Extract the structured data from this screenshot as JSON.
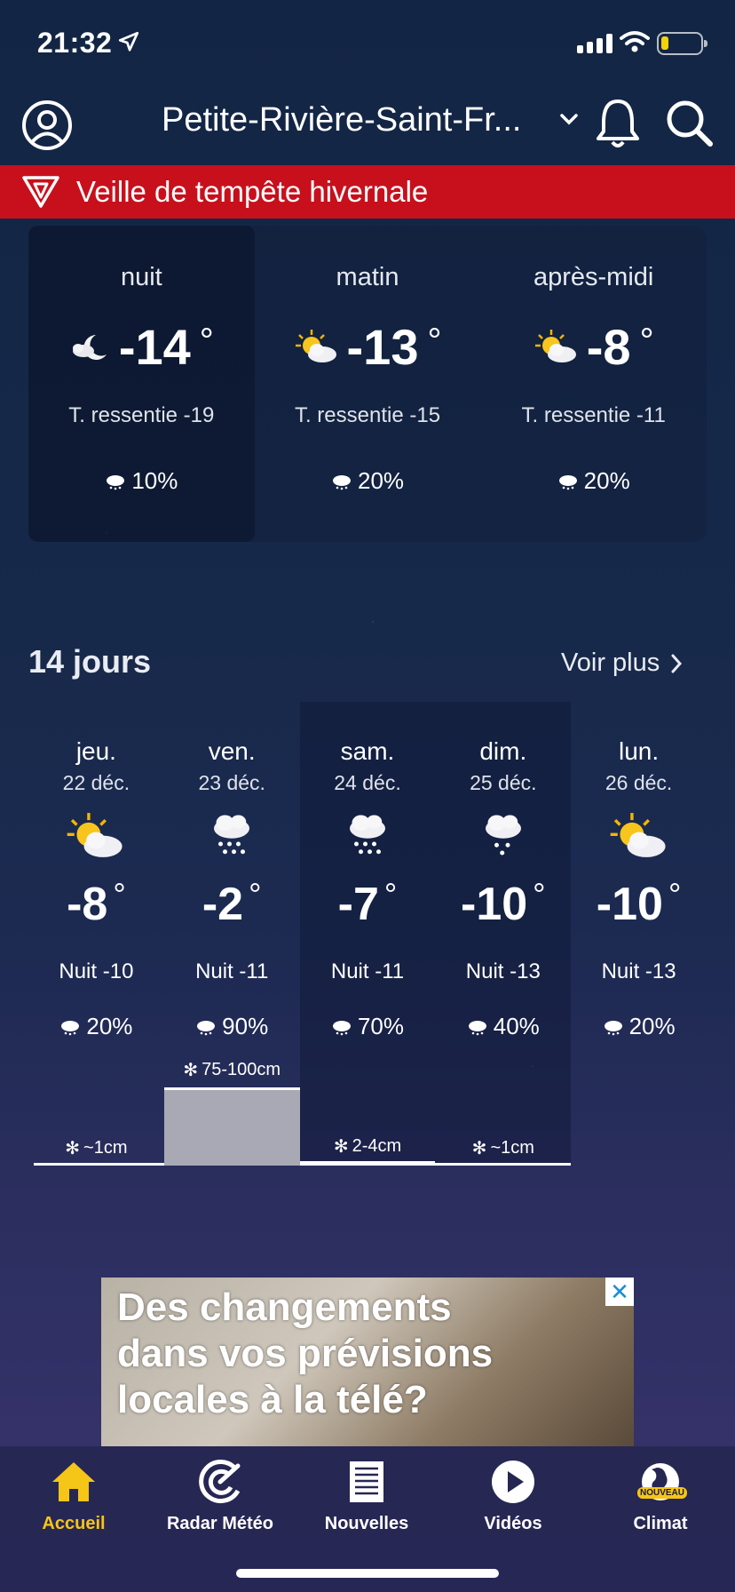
{
  "status_bar": {
    "time": "21:32"
  },
  "header": {
    "city": "Petite-Rivière-Saint-Fr..."
  },
  "alert": {
    "text": "Veille de tempête hivernale"
  },
  "day_parts": [
    {
      "label": "nuit",
      "temp": "-14",
      "unit": "°",
      "feels": "T. ressentie -19",
      "pop": "10%",
      "icon": "moon-cloud-icon"
    },
    {
      "label": "matin",
      "temp": "-13",
      "unit": "°",
      "feels": "T. ressentie -15",
      "pop": "20%",
      "icon": "sun-cloud-icon"
    },
    {
      "label": "après-midi",
      "temp": "-8",
      "unit": "°",
      "feels": "T. ressentie -11",
      "pop": "20%",
      "icon": "sun-cloud-icon"
    }
  ],
  "forecast": {
    "title": "14 jours",
    "more": "Voir plus",
    "days": [
      {
        "name": "jeu.",
        "date": "22 déc.",
        "temp": "-8",
        "unit": "°",
        "night": "Nuit -10",
        "pop": "20%",
        "snow": "~1cm",
        "icon": "sun-cloud-icon"
      },
      {
        "name": "ven.",
        "date": "23 déc.",
        "temp": "-2",
        "unit": "°",
        "night": "Nuit -11",
        "pop": "90%",
        "snow": "75-100cm",
        "icon": "snow-cloud-icon"
      },
      {
        "name": "sam.",
        "date": "24 déc.",
        "temp": "-7",
        "unit": "°",
        "night": "Nuit -11",
        "pop": "70%",
        "snow": "2-4cm",
        "icon": "snow-cloud-icon"
      },
      {
        "name": "dim.",
        "date": "25 déc.",
        "temp": "-10",
        "unit": "°",
        "night": "Nuit -13",
        "pop": "40%",
        "snow": "~1cm",
        "icon": "light-snow-cloud-icon"
      },
      {
        "name": "lun.",
        "date": "26 déc.",
        "temp": "-10",
        "unit": "°",
        "night": "Nuit -13",
        "pop": "20%",
        "snow": "",
        "icon": "sun-cloud-icon"
      }
    ]
  },
  "ad": {
    "line1": "Des changements",
    "line2": "dans vos prévisions",
    "line3": "locales à la télé?",
    "close": "✕"
  },
  "bottom_nav": {
    "home": "Accueil",
    "radar": "Radar Météo",
    "news": "Nouvelles",
    "videos": "Vidéos",
    "climate": "Climat",
    "climate_badge": "NOUVEAU",
    "active_color": "#f5c518"
  }
}
